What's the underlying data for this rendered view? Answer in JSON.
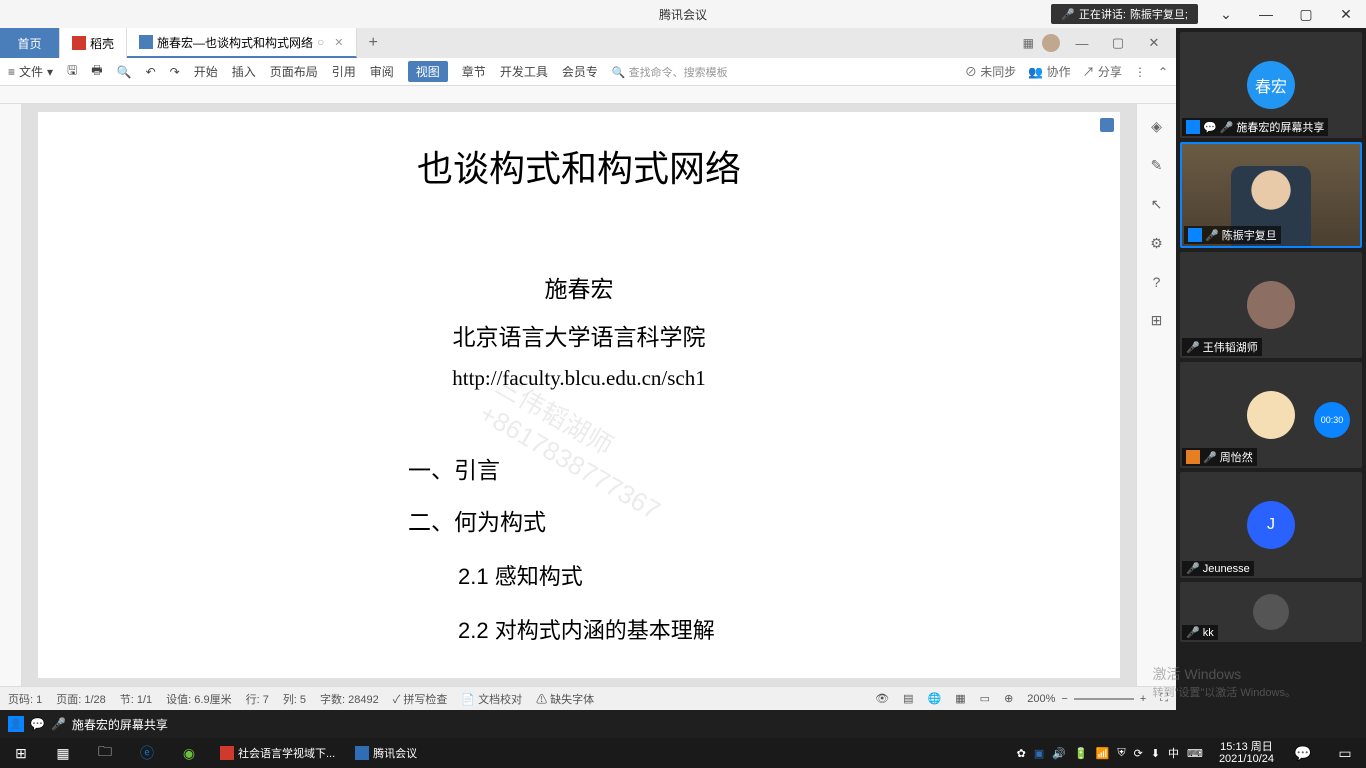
{
  "meeting": {
    "app_title": "腾讯会议",
    "speaking_prefix": "正在讲话:",
    "speaking_name": "陈振宇复旦;"
  },
  "participants": [
    {
      "avatar_text": "春宏",
      "avatar_color": "#2196f3",
      "label": "施春宏的屏幕共享",
      "presenter": true,
      "muted": true
    },
    {
      "label": "陈振宇复旦",
      "video": true,
      "active": true,
      "muted": true
    },
    {
      "avatar_text": "",
      "avatar_color": "#8d6e63",
      "label": "王伟韬湖师",
      "muted": true
    },
    {
      "avatar_text": "",
      "avatar_color": "#f5deb3",
      "label": "周怡然",
      "muted": true,
      "timer": "00:30"
    },
    {
      "avatar_text": "J",
      "avatar_color": "#2962ff",
      "label": "Jeunesse",
      "muted": true
    },
    {
      "avatar_text": "",
      "avatar_color": "#555",
      "label": "kk",
      "muted": true
    }
  ],
  "wps": {
    "tabs": {
      "home": "首页",
      "doke": "稻壳",
      "doc": "施春宏—也谈构式和构式网络"
    },
    "menu": {
      "file": "文件",
      "items": [
        "开始",
        "插入",
        "页面布局",
        "引用",
        "审阅",
        "视图",
        "章节",
        "开发工具",
        "会员专"
      ],
      "active_index": 5,
      "search_placeholder": "查找命令、搜索模板",
      "right": {
        "unsync": "未同步",
        "collab": "协作",
        "share": "分享"
      }
    },
    "status": {
      "page_label": "页码: 1",
      "page_of": "页面: 1/28",
      "section": "节: 1/1",
      "setval": "设值: 6.9厘米",
      "row": "行: 7",
      "col": "列: 5",
      "chars": "字数: 28492",
      "spellcheck": "拼写检查",
      "doccheck": "文档校对",
      "missing_font": "缺失字体",
      "zoom": "200%"
    },
    "document": {
      "title": "也谈构式和构式网络",
      "author": "施春宏",
      "affiliation": "北京语言大学语言科学院",
      "url": "http://faculty.blcu.edu.cn/sch1",
      "sec1": "一、引言",
      "sec2": "二、何为构式",
      "sub21": "2.1 感知构式",
      "sub22": "2.2 对构式内涵的基本理解",
      "watermark_line1": "三伟韬湖师",
      "watermark_line2": "+8617838777367"
    }
  },
  "sharing_bar": {
    "label": "施春宏的屏幕共享"
  },
  "taskbar": {
    "apps": [
      {
        "label": "社会语言学视域下...",
        "color": "#d0392e"
      },
      {
        "label": "腾讯会议",
        "color": "#2f6db5"
      }
    ],
    "clock_time": "15:13",
    "clock_day": "周日",
    "clock_date": "2021/10/24",
    "ime": "中",
    "activate_title": "激活 Windows",
    "activate_sub": "转到\"设置\"以激活 Windows。"
  }
}
